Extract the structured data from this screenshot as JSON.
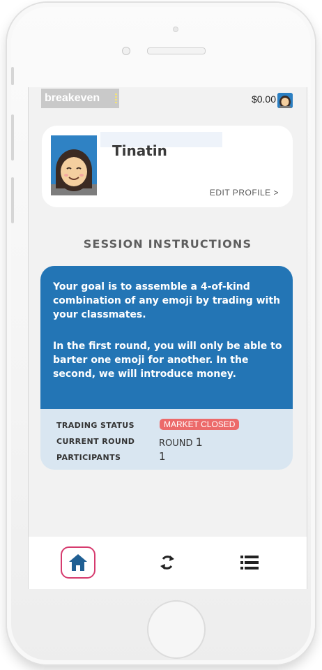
{
  "header": {
    "logo_text": "breakeven",
    "balance": "$0.00"
  },
  "profile": {
    "name": "Tinatin",
    "edit_label": "EDIT PROFILE >"
  },
  "instructions": {
    "title": "SESSION INSTRUCTIONS",
    "paragraphs": [
      "Your goal is to assemble a 4-of-kind combination of any emoji by trading with your classmates.",
      "In the first round, you will only be able to barter one emoji for another. In the second, we will introduce money."
    ]
  },
  "stats": {
    "trading_status_label": "TRADING STATUS",
    "trading_status_value": "MARKET CLOSED",
    "current_round_label": "CURRENT ROUND",
    "current_round_prefix": "ROUND",
    "current_round_number": "1",
    "participants_label": "PARTICIPANTS",
    "participants_value": "1"
  },
  "nav": {
    "items": [
      {
        "name": "home",
        "icon": "home-icon",
        "active": true
      },
      {
        "name": "trade",
        "icon": "sync-icon",
        "active": false
      },
      {
        "name": "list",
        "icon": "list-icon",
        "active": false
      }
    ]
  },
  "colors": {
    "accent_blue": "#2375b5",
    "stat_panel": "#d9e6f1",
    "badge_red": "#ec6a6a",
    "active_outline": "#d63b6e",
    "nav_icon": "#1f5f93"
  }
}
